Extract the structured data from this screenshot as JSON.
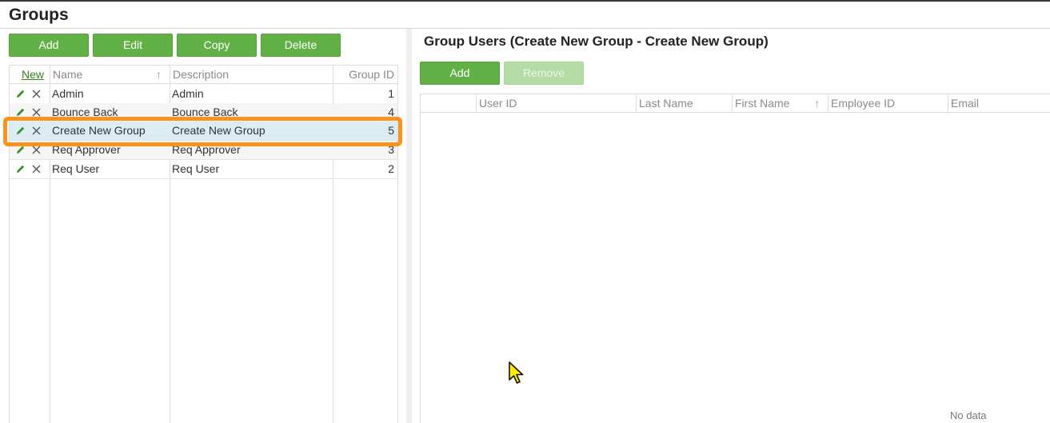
{
  "page": {
    "title": "Groups"
  },
  "groups_toolbar": {
    "add": "Add",
    "edit": "Edit",
    "copy": "Copy",
    "delete": "Delete"
  },
  "groups_grid": {
    "columns": {
      "new": "New",
      "name": "Name",
      "description": "Description",
      "group_id": "Group ID"
    },
    "sort_indicator": "↑",
    "rows": [
      {
        "name": "Admin",
        "description": "Admin",
        "group_id": "1"
      },
      {
        "name": "Bounce Back",
        "description": "Bounce Back",
        "group_id": "4"
      },
      {
        "name": "Create New Group",
        "description": "Create New Group",
        "group_id": "5"
      },
      {
        "name": "Req Approver",
        "description": "Req Approver",
        "group_id": "3"
      },
      {
        "name": "Req User",
        "description": "Req User",
        "group_id": "2"
      }
    ],
    "selected_row": 2
  },
  "group_users": {
    "title": "Group Users (Create New Group - Create New Group)",
    "toolbar": {
      "add": "Add",
      "remove": "Remove"
    },
    "columns": {
      "user_id": "User ID",
      "last_name": "Last Name",
      "first_name": "First Name",
      "employee_id": "Employee ID",
      "email": "Email"
    },
    "sort_indicator": "↑",
    "empty_text": "No data"
  },
  "colors": {
    "accent_green": "#62b146",
    "highlight_orange": "#f7931e",
    "selected_row": "#dcecf5"
  }
}
